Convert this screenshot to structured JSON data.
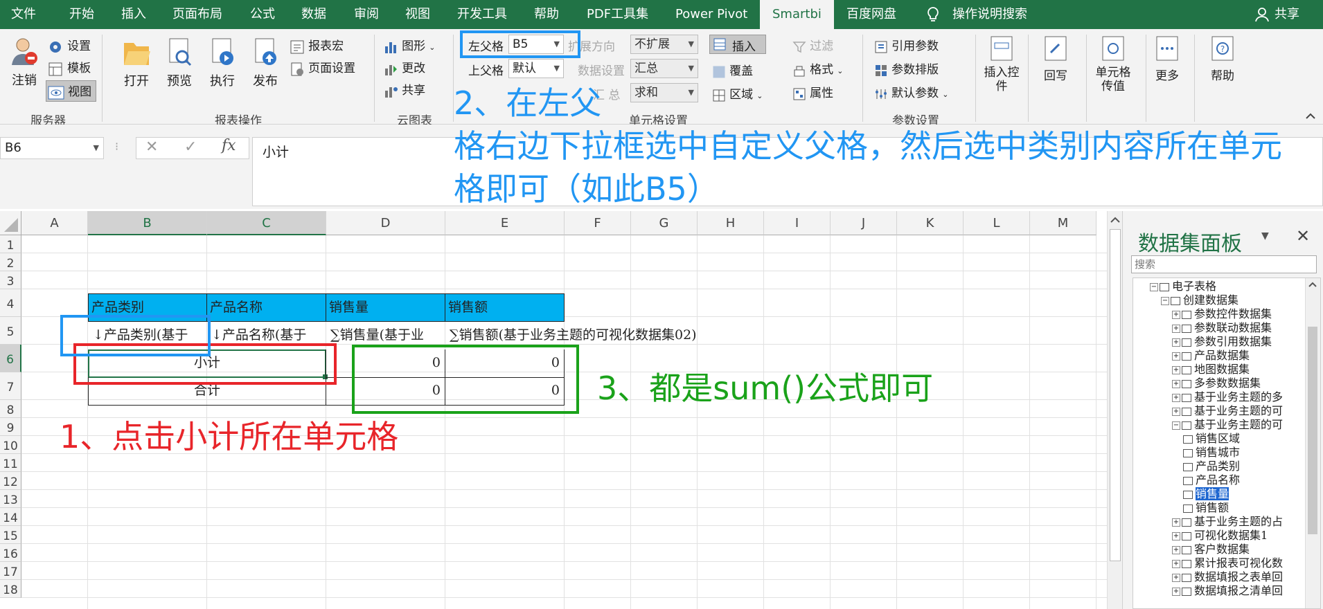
{
  "tabs": [
    "文件",
    "开始",
    "插入",
    "页面布局",
    "公式",
    "数据",
    "审阅",
    "视图",
    "开发工具",
    "帮助",
    "PDF工具集",
    "Power Pivot",
    "Smartbi",
    "百度网盘",
    "操作说明搜索",
    "共享"
  ],
  "ribbon": {
    "server": {
      "logout": "注销",
      "settings": "设置",
      "template": "模板",
      "view": "视图",
      "label": "服务器"
    },
    "report": {
      "open": "打开",
      "preview": "预览",
      "execute": "执行",
      "publish": "发布",
      "macro": "报表宏",
      "page_setup": "页面设置",
      "label": "报表操作"
    },
    "cloud": {
      "chart": "图形",
      "change": "更改",
      "share": "共享",
      "label": "云图表"
    },
    "cell": {
      "left_parent": "左父格",
      "left_parent_value": "B5",
      "top_parent": "上父格",
      "top_parent_value": "默认",
      "expand_dir": "扩展方向",
      "expand_value": "不扩展",
      "data_setting": "数据设置",
      "data_value": "汇总",
      "summary": "汇  总",
      "summary_value": "求和",
      "insert": "插入",
      "cover": "覆盖",
      "area": "区域",
      "filter": "过滤",
      "format": "格式",
      "property": "属性",
      "label": "单元格设置"
    },
    "params": {
      "ref": "引用参数",
      "sort": "参数排版",
      "default": "默认参数",
      "label": "参数设置"
    },
    "others": {
      "insert_control": "插入控件",
      "writeback": "回写",
      "cell_value": "单元格传值",
      "more": "更多",
      "help": "帮助"
    }
  },
  "formula": {
    "namebox": "B6",
    "content": "小计"
  },
  "sheet": {
    "columns": [
      "A",
      "B",
      "C",
      "D",
      "E",
      "F",
      "G",
      "H",
      "I",
      "J",
      "K",
      "L",
      "M"
    ],
    "rows": [
      "1",
      "2",
      "3",
      "4",
      "5",
      "6",
      "7",
      "8",
      "9",
      "10",
      "11",
      "12",
      "13",
      "14",
      "15",
      "16",
      "17",
      "18"
    ],
    "headers": [
      "产品类别",
      "产品名称",
      "销售量",
      "销售额"
    ],
    "row5": [
      "↓产品类别(基于",
      "↓产品名称(基于",
      "∑销售量(基于业",
      "∑销售额(基于业务主题的可视化数据集02)"
    ],
    "row6": {
      "label": "小计",
      "d": "0",
      "e": "0"
    },
    "row7": {
      "label": "合计",
      "d": "0",
      "e": "0"
    }
  },
  "annotations": {
    "a1": "1、点击小计所在单元格",
    "a2_line1": "2、在左父",
    "a2_line2": "格右边下拉框选中自定义父格，然后选中类别内容所在单元",
    "a2_line3": "格即可（如此B5）",
    "a3": "3、都是sum()公式即可"
  },
  "panel": {
    "title": "数据集面板",
    "search_placeholder": "搜索",
    "tree": [
      {
        "label": "电子表格",
        "level": 0,
        "mark": "minus"
      },
      {
        "label": "创建数据集",
        "level": 1,
        "mark": "minus"
      },
      {
        "label": "参数控件数据集",
        "level": 2,
        "mark": "plus"
      },
      {
        "label": "参数联动数据集",
        "level": 2,
        "mark": "plus"
      },
      {
        "label": "参数引用数据集",
        "level": 2,
        "mark": "plus"
      },
      {
        "label": "产品数据集",
        "level": 2,
        "mark": "plus"
      },
      {
        "label": "地图数据集",
        "level": 2,
        "mark": "plus"
      },
      {
        "label": "多参数数据集",
        "level": 2,
        "mark": "plus"
      },
      {
        "label": "基于业务主题的多",
        "level": 2,
        "mark": "plus"
      },
      {
        "label": "基于业务主题的可",
        "level": 2,
        "mark": "plus"
      },
      {
        "label": "基于业务主题的可",
        "level": 2,
        "mark": "minus"
      },
      {
        "label": "销售区域",
        "level": 3,
        "mark": "none"
      },
      {
        "label": "销售城市",
        "level": 3,
        "mark": "none"
      },
      {
        "label": "产品类别",
        "level": 3,
        "mark": "none"
      },
      {
        "label": "产品名称",
        "level": 3,
        "mark": "none"
      },
      {
        "label": "销售量",
        "level": 3,
        "mark": "none",
        "selected": true
      },
      {
        "label": "销售额",
        "level": 3,
        "mark": "none"
      },
      {
        "label": "基于业务主题的占",
        "level": 2,
        "mark": "plus"
      },
      {
        "label": "可视化数据集1",
        "level": 2,
        "mark": "plus"
      },
      {
        "label": "客户数据集",
        "level": 2,
        "mark": "plus"
      },
      {
        "label": "累计报表可视化数",
        "level": 2,
        "mark": "plus"
      },
      {
        "label": "数据填报之表单回",
        "level": 2,
        "mark": "plus"
      },
      {
        "label": "数据填报之清单回",
        "level": 2,
        "mark": "plus"
      }
    ]
  },
  "colors": {
    "excel_green": "#217346",
    "header_fill": "#00b0f0",
    "red": "#e8252a",
    "blue": "#2196f3",
    "green": "#1aa21a"
  }
}
